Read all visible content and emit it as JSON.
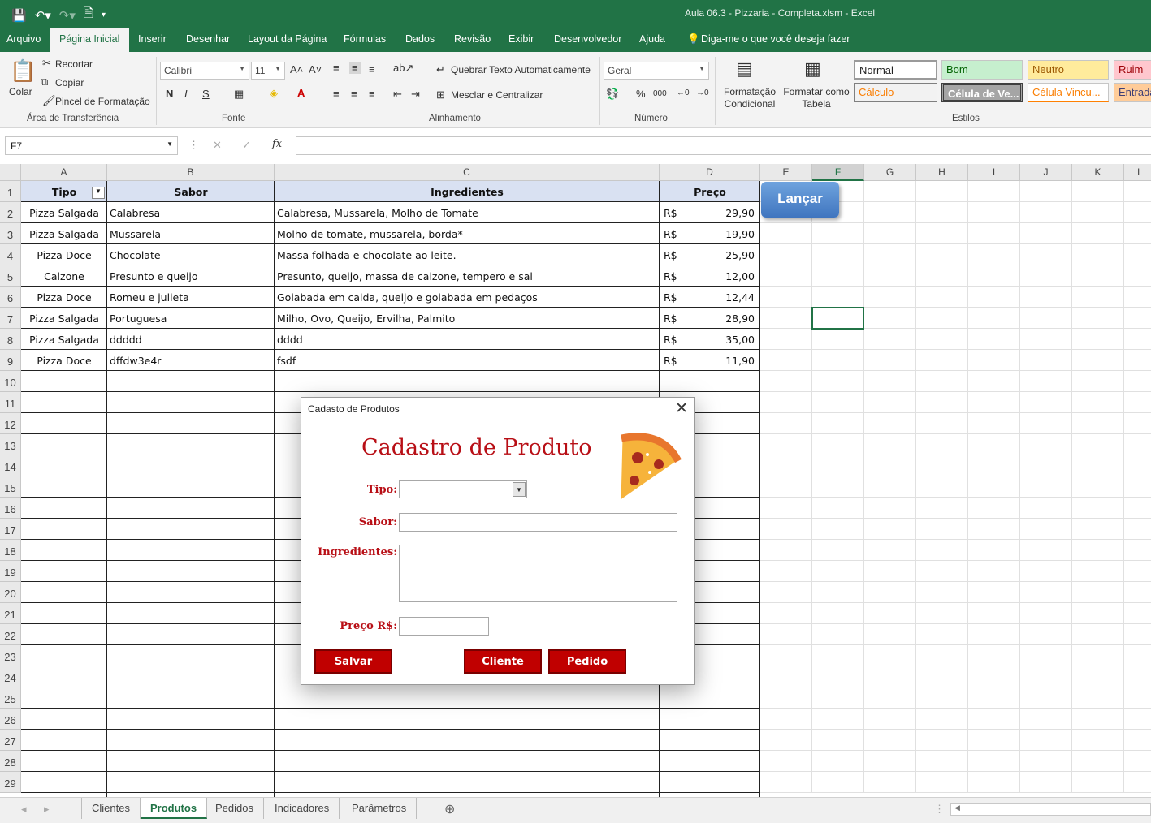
{
  "window": {
    "title": "Aula 06.3 - Pizzaria - Completa.xlsm  -  Excel"
  },
  "ribbon_tabs": [
    "Arquivo",
    "Página Inicial",
    "Inserir",
    "Desenhar",
    "Layout da Página",
    "Fórmulas",
    "Dados",
    "Revisão",
    "Exibir",
    "Desenvolvedor",
    "Ajuda"
  ],
  "tell_me": "Diga-me o que você deseja fazer",
  "clipboard": {
    "paste": "Colar",
    "cut": "Recortar",
    "copy": "Copiar",
    "painter": "Pincel de Formatação",
    "group": "Área de Transferência"
  },
  "font": {
    "name": "Calibri",
    "size": "11",
    "bold": "N",
    "italic": "I",
    "underline": "S",
    "group": "Fonte"
  },
  "alignment": {
    "wrap": "Quebrar Texto Automaticamente",
    "merge": "Mesclar e Centralizar",
    "group": "Alinhamento"
  },
  "number": {
    "format": "Geral",
    "percent": "%",
    "thousands": "000",
    "group": "Número"
  },
  "styles": {
    "conditional": "Formatação Condicional",
    "table": "Formatar como Tabela",
    "group": "Estilos",
    "cells": [
      "Normal",
      "Bom",
      "Neutro",
      "Ruim",
      "Cálculo",
      "Célula de Ve...",
      "Célula Vincu...",
      "Entrada"
    ]
  },
  "formula_bar": {
    "name_box": "F7",
    "fx": "fx",
    "content": ""
  },
  "columns": [
    "A",
    "B",
    "C",
    "D",
    "E",
    "F",
    "G",
    "H",
    "I",
    "J",
    "K",
    "L"
  ],
  "rows": [
    "1",
    "2",
    "3",
    "4",
    "5",
    "6",
    "7",
    "8",
    "9",
    "10",
    "11",
    "12",
    "13",
    "14",
    "15",
    "16",
    "17",
    "18",
    "19",
    "20",
    "21",
    "22",
    "23",
    "24",
    "25",
    "26",
    "27",
    "28",
    "29"
  ],
  "table": {
    "headers": [
      "Tipo",
      "Sabor",
      "Ingredientes",
      "Preço"
    ],
    "currency": "R$",
    "rows": [
      [
        "Pizza Salgada",
        "Calabresa",
        "Calabresa, Mussarela, Molho de Tomate",
        "29,90"
      ],
      [
        "Pizza Salgada",
        "Mussarela",
        "Molho de tomate, mussarela, borda*",
        "19,90"
      ],
      [
        "Pizza Doce",
        "Chocolate",
        "Massa folhada e chocolate ao leite.",
        "25,90"
      ],
      [
        "Calzone",
        "Presunto e queijo",
        "Presunto, queijo, massa de calzone, tempero e sal",
        "12,00"
      ],
      [
        "Pizza Doce",
        "Romeu e julieta",
        "Goiabada em calda, queijo e goiabada em pedaços",
        "12,44"
      ],
      [
        "Pizza Salgada",
        "Portuguesa",
        "Milho, Ovo, Queijo, Ervilha, Palmito",
        "28,90"
      ],
      [
        "Pizza Salgada",
        "ddddd",
        "dddd",
        "35,00"
      ],
      [
        "Pizza Doce",
        "dffdw3e4r",
        "fsdf",
        "11,90"
      ]
    ]
  },
  "lancar_button": "Lançar",
  "dialog": {
    "title": "Cadasto de Produtos",
    "heading": "Cadastro de Produto",
    "labels": {
      "tipo": "Tipo:",
      "sabor": "Sabor:",
      "ingredientes": "Ingredientes:",
      "preco": "Preço R$:"
    },
    "buttons": {
      "salvar": "Salvar",
      "cliente": "Cliente",
      "pedido": "Pedido"
    }
  },
  "sheets": [
    "Clientes",
    "Produtos",
    "Pedidos",
    "Indicadores",
    "Parâmetros"
  ],
  "active_sheet": "Produtos",
  "colors": {
    "excel_green": "#217346",
    "header_fill": "#d9e1f2",
    "button_red": "#c00000",
    "label_red": "#b80f16"
  }
}
